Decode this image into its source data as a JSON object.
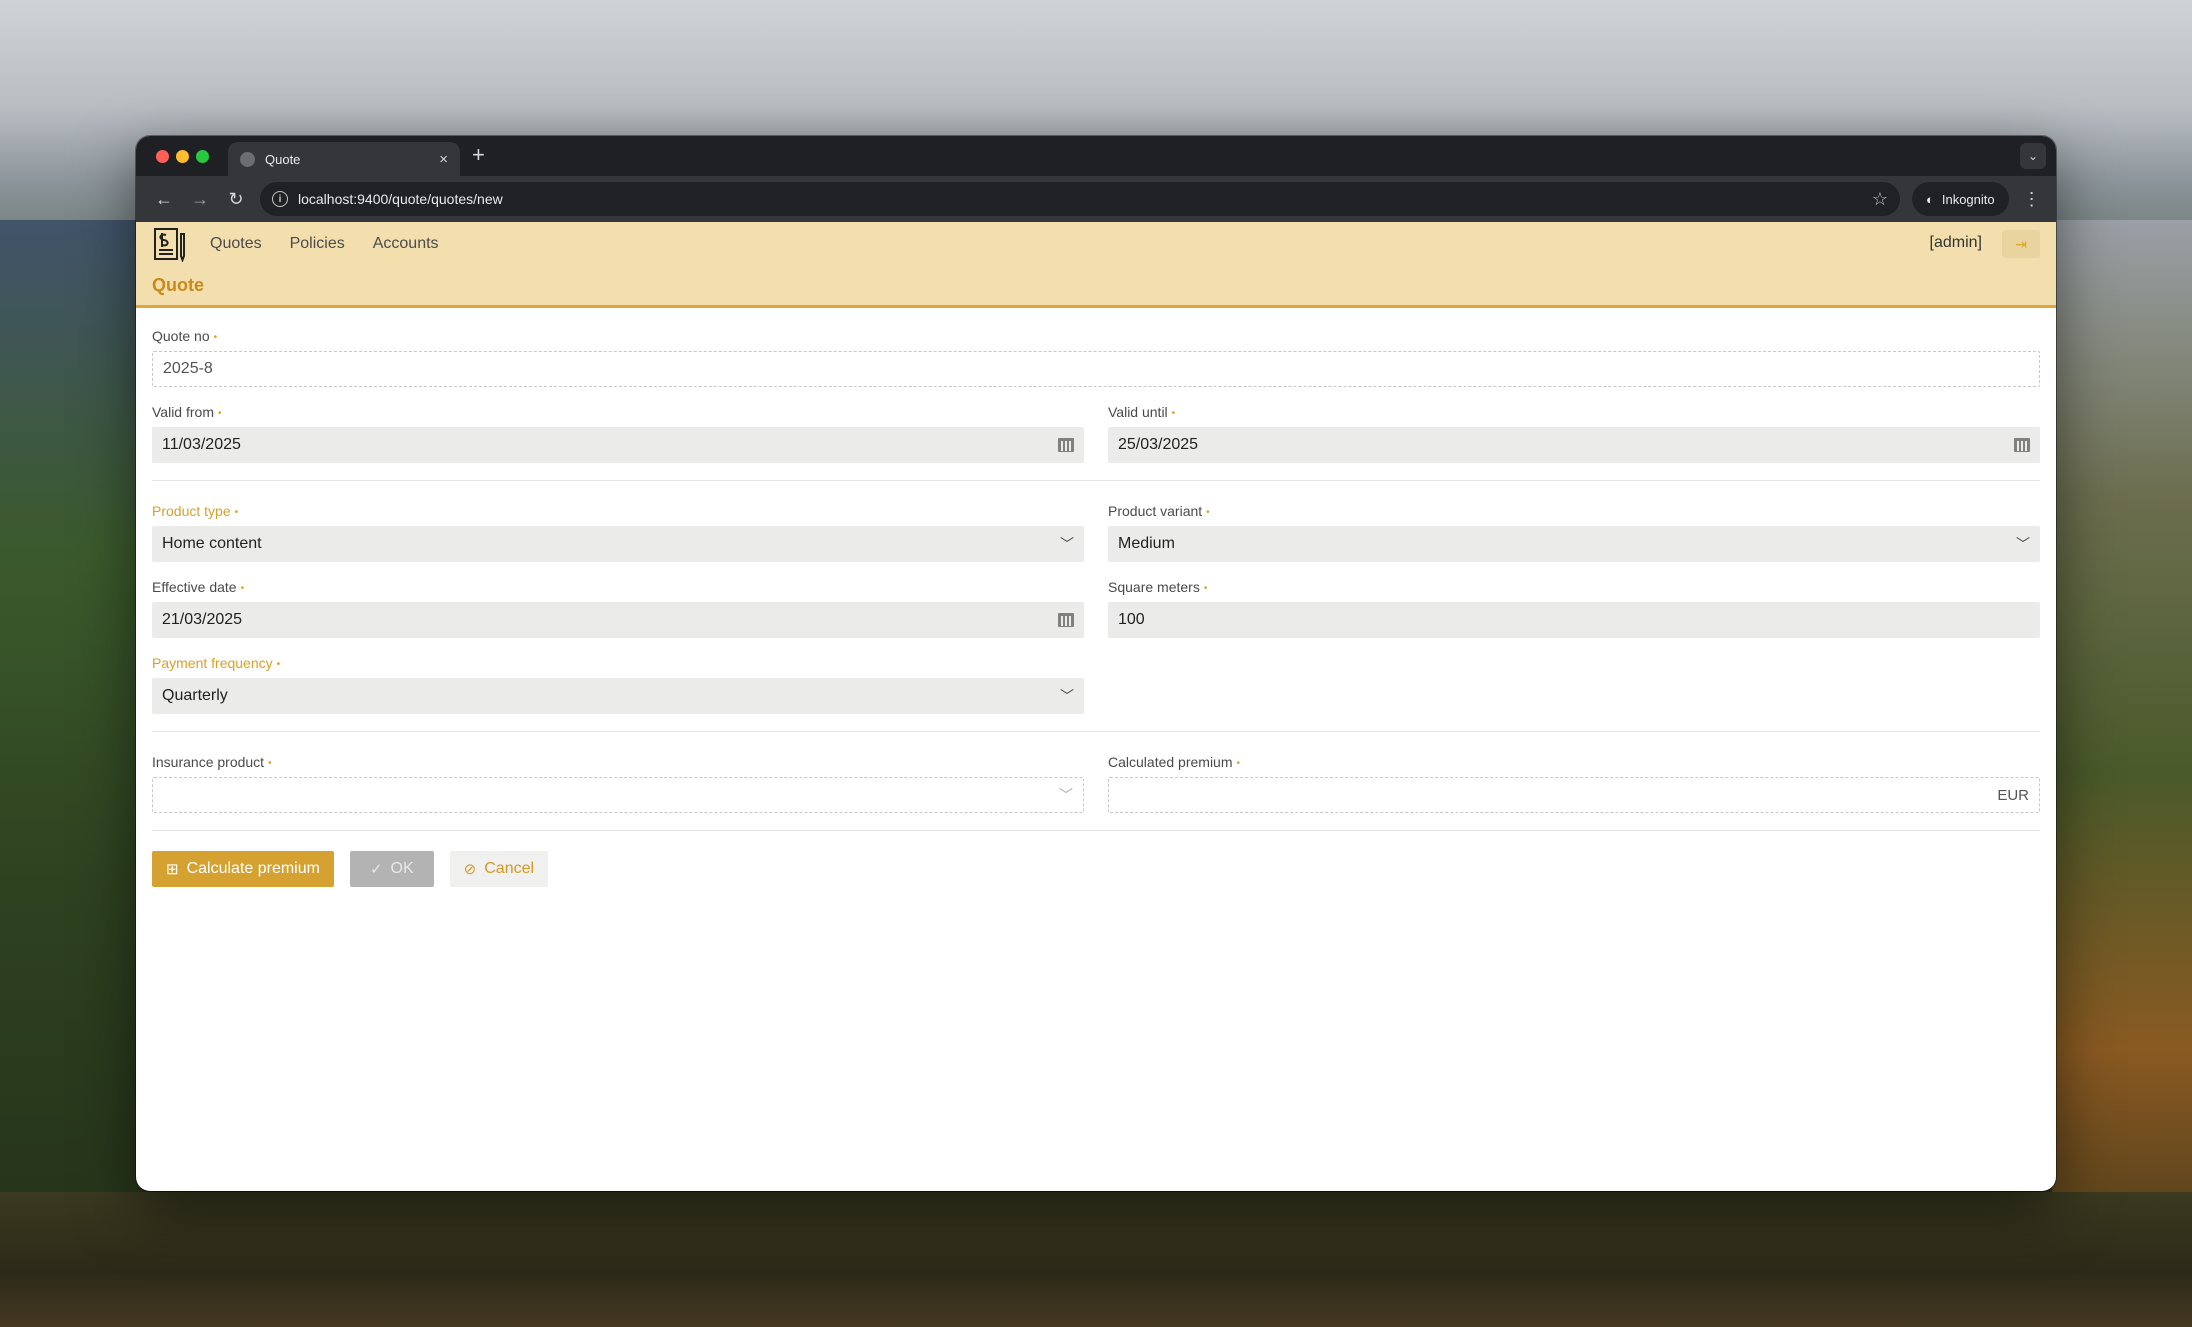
{
  "browser": {
    "tab_title": "Quote",
    "tab_close": "×",
    "new_tab": "+",
    "url": "localhost:9400/quote/quotes/new",
    "incognito_label": "Inkognito"
  },
  "app": {
    "nav": [
      "Quotes",
      "Policies",
      "Accounts"
    ],
    "user": "[admin]",
    "page_title": "Quote"
  },
  "form": {
    "quote_no": {
      "label": "Quote no",
      "value": "2025-8"
    },
    "valid_from": {
      "label": "Valid from",
      "value": "11/03/2025"
    },
    "valid_until": {
      "label": "Valid until",
      "value": "25/03/2025"
    },
    "product_type": {
      "label": "Product type",
      "value": "Home content"
    },
    "product_variant": {
      "label": "Product variant",
      "value": "Medium"
    },
    "effective_date": {
      "label": "Effective date",
      "value": "21/03/2025"
    },
    "square_meters": {
      "label": "Square meters",
      "value": "100"
    },
    "payment_frequency": {
      "label": "Payment frequency",
      "value": "Quarterly"
    },
    "insurance_product": {
      "label": "Insurance product",
      "value": ""
    },
    "calculated_premium": {
      "label": "Calculated premium",
      "value": "",
      "unit": "EUR"
    }
  },
  "buttons": {
    "calculate": "Calculate premium",
    "ok": "OK",
    "cancel": "Cancel"
  },
  "colors": {
    "header_bg": "#f3dfae",
    "accent": "#d5a232",
    "title": "#c98a1a"
  }
}
